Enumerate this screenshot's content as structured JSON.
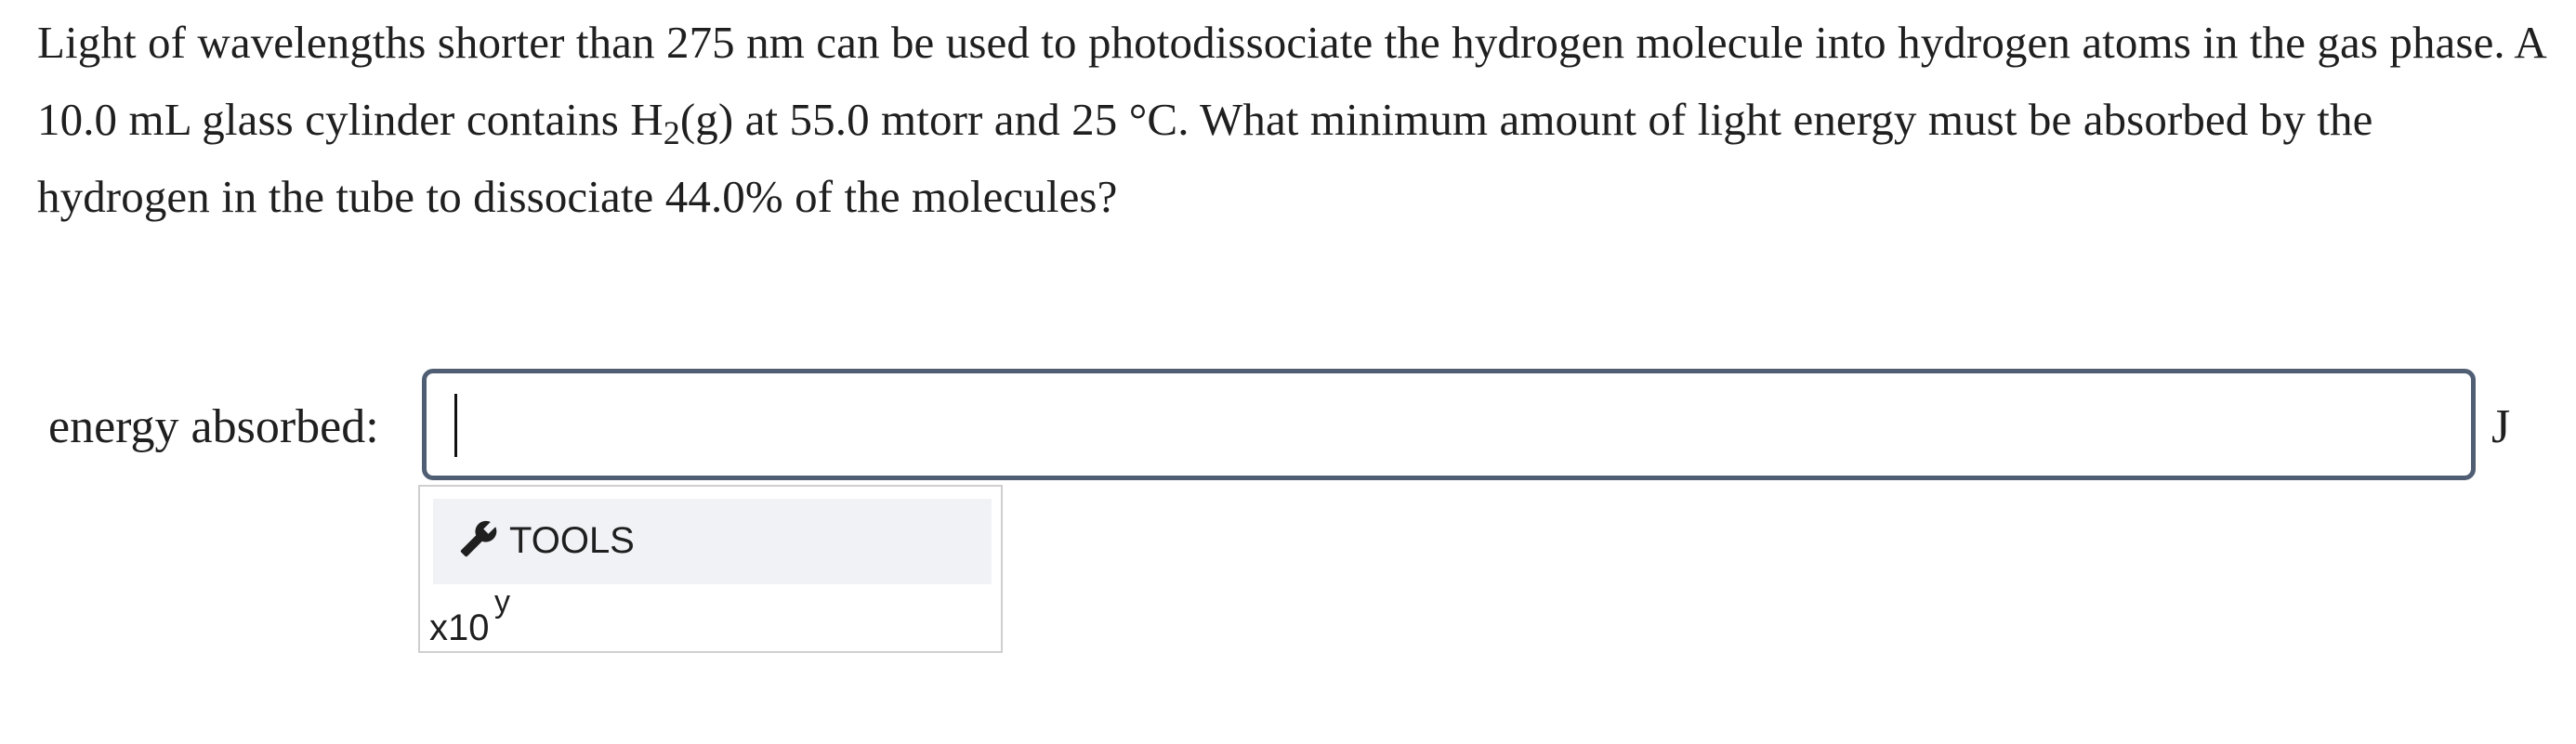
{
  "question": {
    "text_before_sub": "Light of wavelengths shorter than 275 nm can be used to photodissociate the hydrogen molecule into hydrogen atoms in the gas phase. A 10.0 mL glass cylinder contains H",
    "subscript": "2",
    "text_after_sub": "(g) at 55.0 mtorr and 25 °C. What minimum amount of light energy must be absorbed by the hydrogen in the tube to dissociate 44.0% of the molecules?"
  },
  "answer": {
    "label": "energy absorbed:",
    "value": "",
    "unit": "J"
  },
  "tools": {
    "header_label": "TOOLS",
    "header_icon": "wrench-icon",
    "sci_notation_base": "x10",
    "sci_notation_exponent": "y"
  },
  "colors": {
    "input_border": "#4f5e73",
    "tools_header_bg": "#f1f2f6",
    "panel_border": "#cfcfcf"
  }
}
